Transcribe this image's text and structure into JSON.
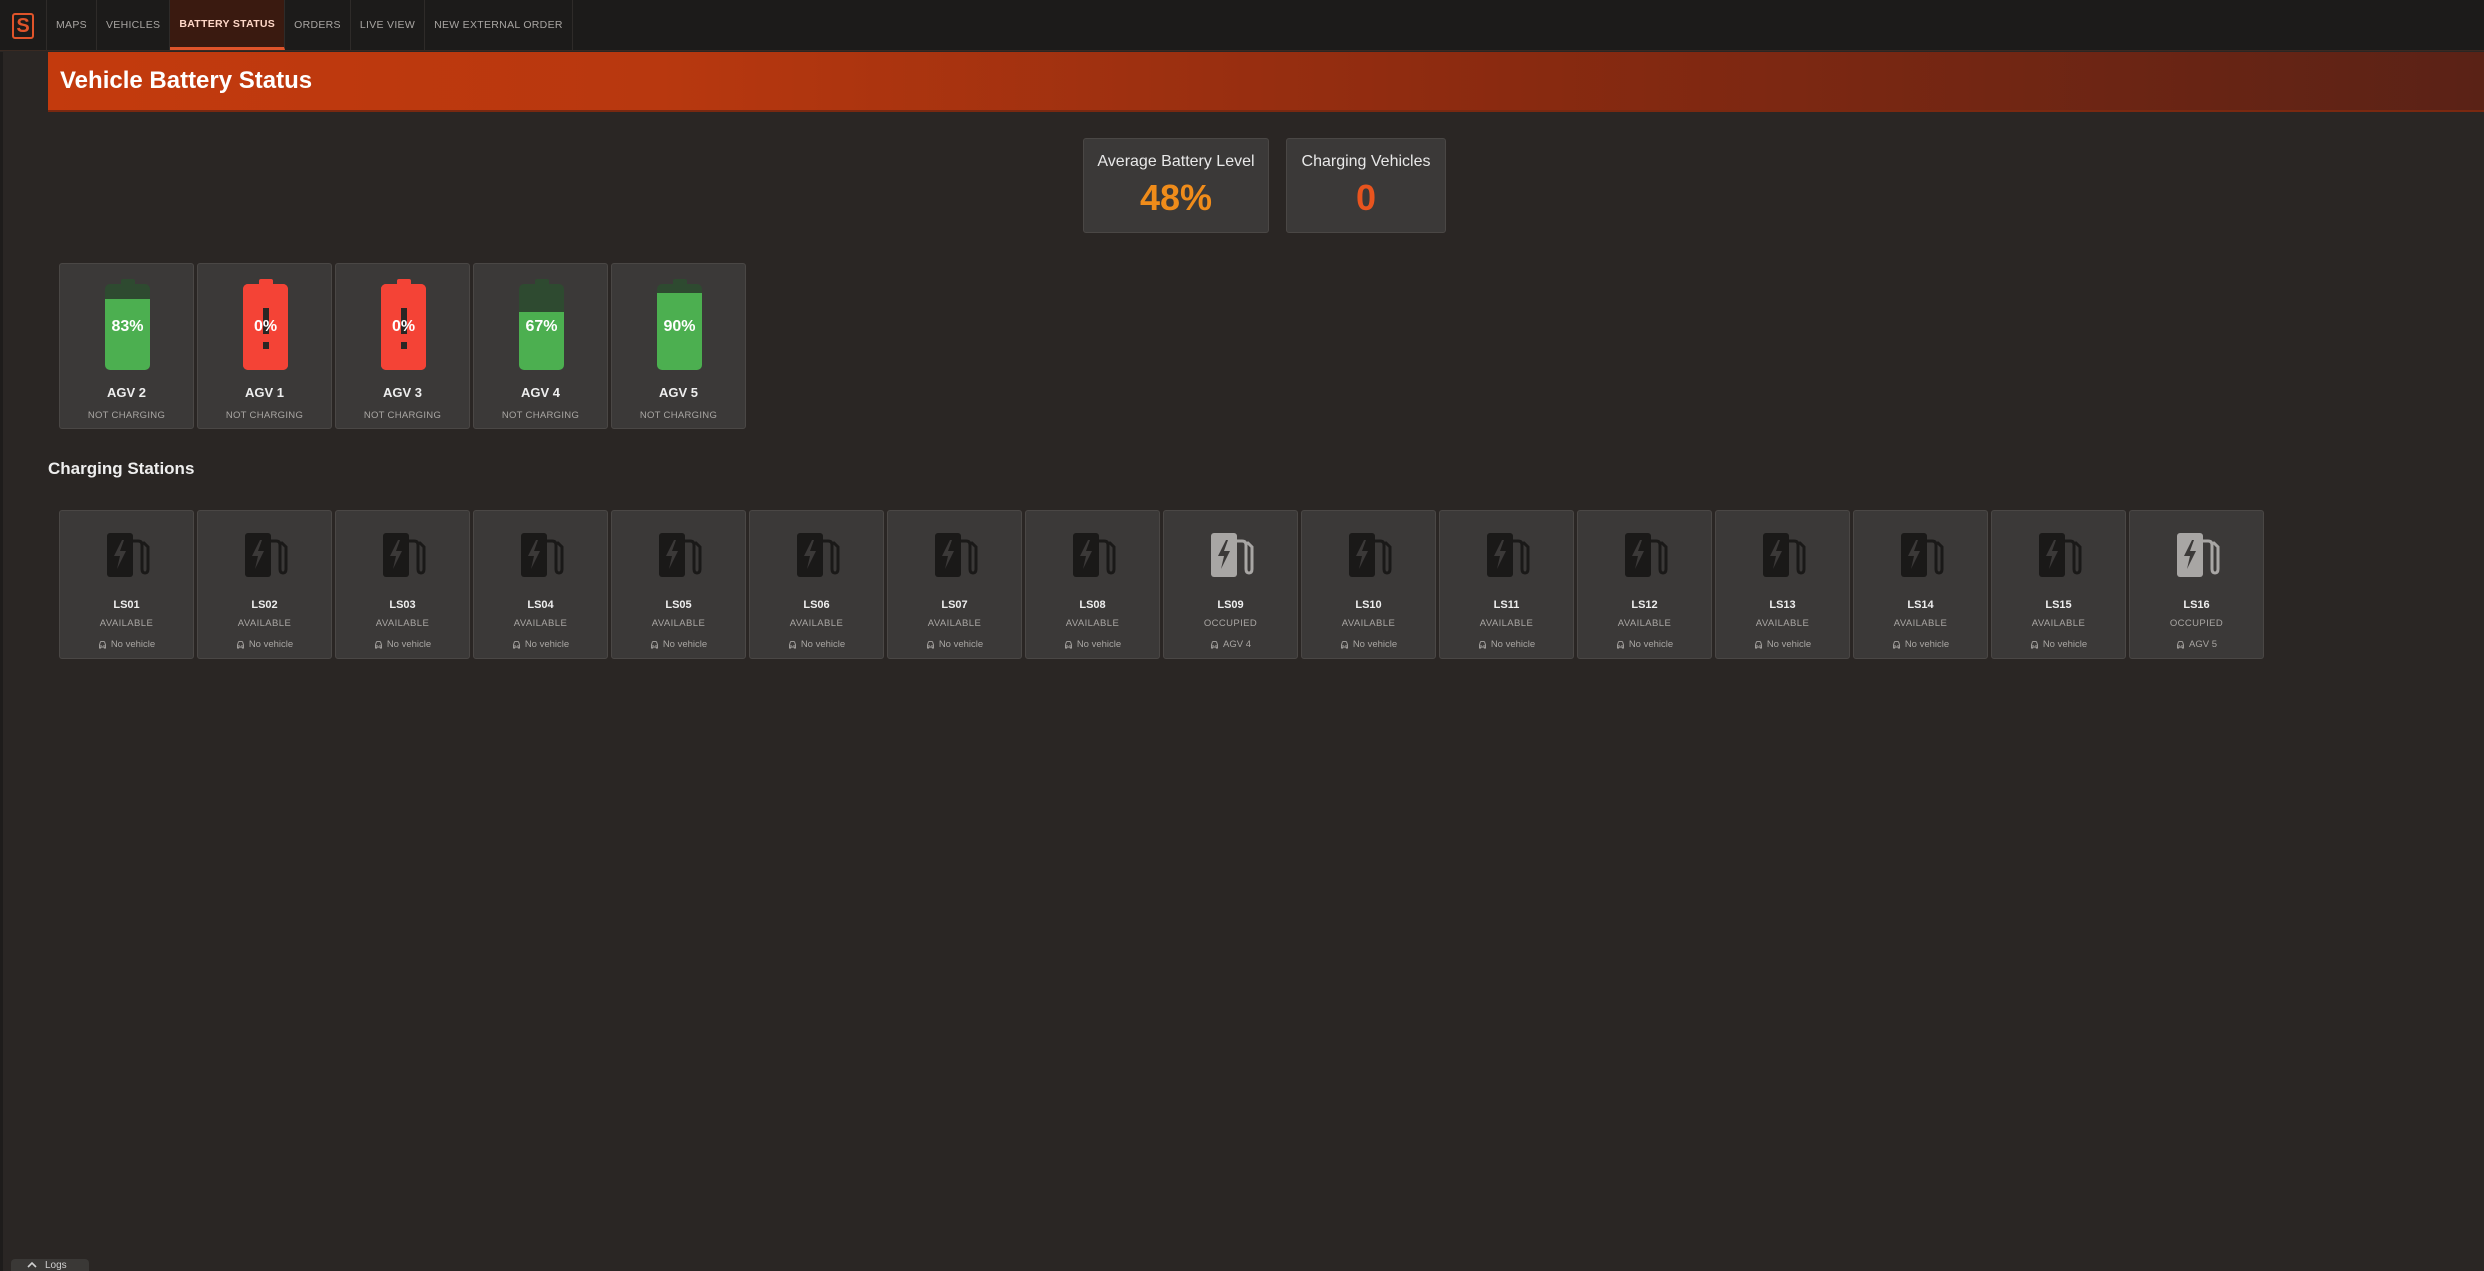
{
  "nav": {
    "tabs": [
      {
        "label": "MAPS",
        "active": false
      },
      {
        "label": "VEHICLES",
        "active": false
      },
      {
        "label": "BATTERY STATUS",
        "active": true
      },
      {
        "label": "ORDERS",
        "active": false
      },
      {
        "label": "LIVE VIEW",
        "active": false
      },
      {
        "label": "NEW EXTERNAL ORDER",
        "active": false
      }
    ]
  },
  "header": {
    "title": "Vehicle Battery Status"
  },
  "stats": {
    "avg_label": "Average Battery Level",
    "avg_value": "48%",
    "charging_label": "Charging Vehicles",
    "charging_value": "0"
  },
  "vehicles": [
    {
      "name": "AGV 2",
      "level": 83,
      "level_label": "83%",
      "status": "NOT CHARGING"
    },
    {
      "name": "AGV 1",
      "level": 0,
      "level_label": "0%",
      "status": "NOT CHARGING"
    },
    {
      "name": "AGV 3",
      "level": 0,
      "level_label": "0%",
      "status": "NOT CHARGING"
    },
    {
      "name": "AGV 4",
      "level": 67,
      "level_label": "67%",
      "status": "NOT CHARGING"
    },
    {
      "name": "AGV 5",
      "level": 90,
      "level_label": "90%",
      "status": "NOT CHARGING"
    }
  ],
  "stations_title": "Charging Stations",
  "stations": [
    {
      "name": "LS01",
      "status": "AVAILABLE",
      "vehicle": "No vehicle"
    },
    {
      "name": "LS02",
      "status": "AVAILABLE",
      "vehicle": "No vehicle"
    },
    {
      "name": "LS03",
      "status": "AVAILABLE",
      "vehicle": "No vehicle"
    },
    {
      "name": "LS04",
      "status": "AVAILABLE",
      "vehicle": "No vehicle"
    },
    {
      "name": "LS05",
      "status": "AVAILABLE",
      "vehicle": "No vehicle"
    },
    {
      "name": "LS06",
      "status": "AVAILABLE",
      "vehicle": "No vehicle"
    },
    {
      "name": "LS07",
      "status": "AVAILABLE",
      "vehicle": "No vehicle"
    },
    {
      "name": "LS08",
      "status": "AVAILABLE",
      "vehicle": "No vehicle"
    },
    {
      "name": "LS09",
      "status": "OCCUPIED",
      "vehicle": "AGV 4"
    },
    {
      "name": "LS10",
      "status": "AVAILABLE",
      "vehicle": "No vehicle"
    },
    {
      "name": "LS11",
      "status": "AVAILABLE",
      "vehicle": "No vehicle"
    },
    {
      "name": "LS12",
      "status": "AVAILABLE",
      "vehicle": "No vehicle"
    },
    {
      "name": "LS13",
      "status": "AVAILABLE",
      "vehicle": "No vehicle"
    },
    {
      "name": "LS14",
      "status": "AVAILABLE",
      "vehicle": "No vehicle"
    },
    {
      "name": "LS15",
      "status": "AVAILABLE",
      "vehicle": "No vehicle"
    },
    {
      "name": "LS16",
      "status": "OCCUPIED",
      "vehicle": "AGV 5"
    }
  ],
  "footer": {
    "logs_label": "Logs"
  },
  "colors": {
    "accent": "#e0542a",
    "battery_good": "#4caf50",
    "battery_good_empty": "#2e4a30",
    "battery_low": "#f44336",
    "pump_available": "#1a1918",
    "pump_occupied": "#a8a6a4"
  },
  "icons": {
    "logo": "app-logo-icon",
    "station": "ev-charger-icon",
    "vehicle": "car-icon",
    "logs": "chevron-up-icon"
  }
}
